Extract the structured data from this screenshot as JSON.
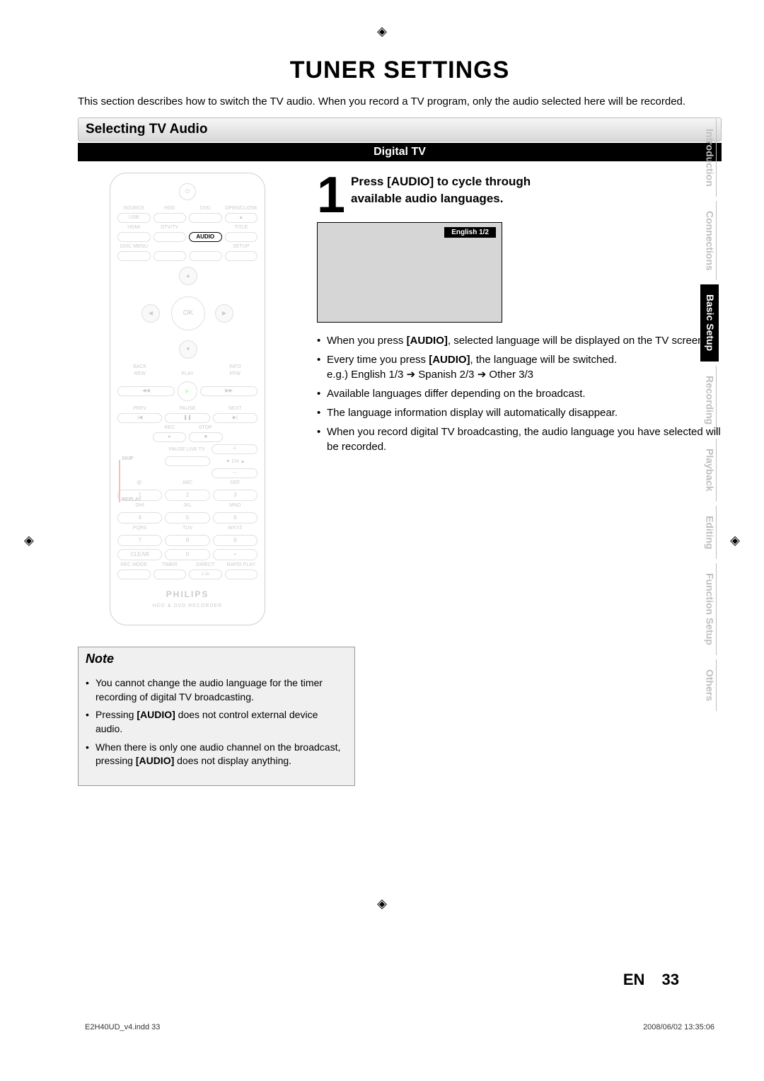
{
  "page_title": "TUNER SETTINGS",
  "intro": "This section describes how to switch the TV audio. When you record a TV program, only the audio selected here will be recorded.",
  "section_header": "Selecting TV Audio",
  "subsection_header": "Digital TV",
  "step": {
    "number": "1",
    "line1": "Press [AUDIO] to cycle through",
    "line2": "available audio languages."
  },
  "osd_label": "English 1/2",
  "remote": {
    "row1_labels": [
      "SOURCE",
      "HDD",
      "DVD",
      "OPEN/CLOSE"
    ],
    "row1_btns": [
      "USB",
      "",
      "",
      "▲"
    ],
    "row2_labels": [
      "HDMI",
      "DTV/TV",
      "",
      "TITLE"
    ],
    "audio_btn": "AUDIO",
    "row3_labels": [
      "DISC MENU",
      "",
      "",
      "SETUP"
    ],
    "dpad_ok": "OK",
    "back": "BACK",
    "info": "INFO",
    "rew": "REW",
    "play_label": "PLAY",
    "ffw": "FFW",
    "prev": "PREV",
    "pause": "PAUSE",
    "next": "NEXT",
    "rec": "REC",
    "stop": "STOP",
    "skip": "SKIP",
    "pauselive": "PAUSE LIVE TV",
    "ch": "▼ CH ▲",
    "replay": "REPLAY",
    "num_labels": [
      "@.",
      "ABC",
      "DEF",
      "GHI",
      "JKL",
      "MNO",
      "PQRS",
      "TUV",
      "WXYZ"
    ],
    "nums": [
      "1",
      "2",
      "3",
      "4",
      "5",
      "6",
      "7",
      "8",
      "9",
      "CLEAR",
      "0",
      "•"
    ],
    "bottom_row": [
      "REC MODE",
      "TIMER",
      "DIRECT",
      "RAPID PLAY"
    ],
    "brand": "PHILIPS",
    "subbrand": "HDD & DVD RECORDER"
  },
  "bullets": [
    {
      "pre": "When you press ",
      "bold": "[AUDIO]",
      "post": ", selected language will be displayed on the TV screen."
    },
    {
      "pre": "Every time you press ",
      "bold": "[AUDIO]",
      "post": ", the language will be switched.",
      "extra": "e.g.) English 1/3 ➔ Spanish 2/3 ➔ Other 3/3"
    },
    {
      "pre": "Available languages differ depending on the broadcast.",
      "bold": "",
      "post": ""
    },
    {
      "pre": "The language information display will automatically disappear.",
      "bold": "",
      "post": ""
    },
    {
      "pre": "When you record digital TV broadcasting, the audio language you have selected will be recorded.",
      "bold": "",
      "post": ""
    }
  ],
  "note": {
    "title": "Note",
    "items": [
      {
        "pre": "You cannot change the audio language for the timer recording of digital TV broadcasting.",
        "bold": "",
        "post": ""
      },
      {
        "pre": "Pressing ",
        "bold": "[AUDIO]",
        "post": " does not control external device audio."
      },
      {
        "pre": "When there is only one audio channel on the broadcast, pressing ",
        "bold": "[AUDIO]",
        "post": " does not display anything."
      }
    ]
  },
  "side_tabs": [
    {
      "label": "Introduction",
      "active": false
    },
    {
      "label": "Connections",
      "active": false
    },
    {
      "label": "Basic Setup",
      "active": true
    },
    {
      "label": "Recording",
      "active": false
    },
    {
      "label": "Playback",
      "active": false
    },
    {
      "label": "Editing",
      "active": false
    },
    {
      "label": "Function Setup",
      "active": false
    },
    {
      "label": "Others",
      "active": false
    }
  ],
  "footer": {
    "lang": "EN",
    "page": "33",
    "file": "E2H40UD_v4.indd   33",
    "timestamp": "2008/06/02   13:35:06"
  }
}
